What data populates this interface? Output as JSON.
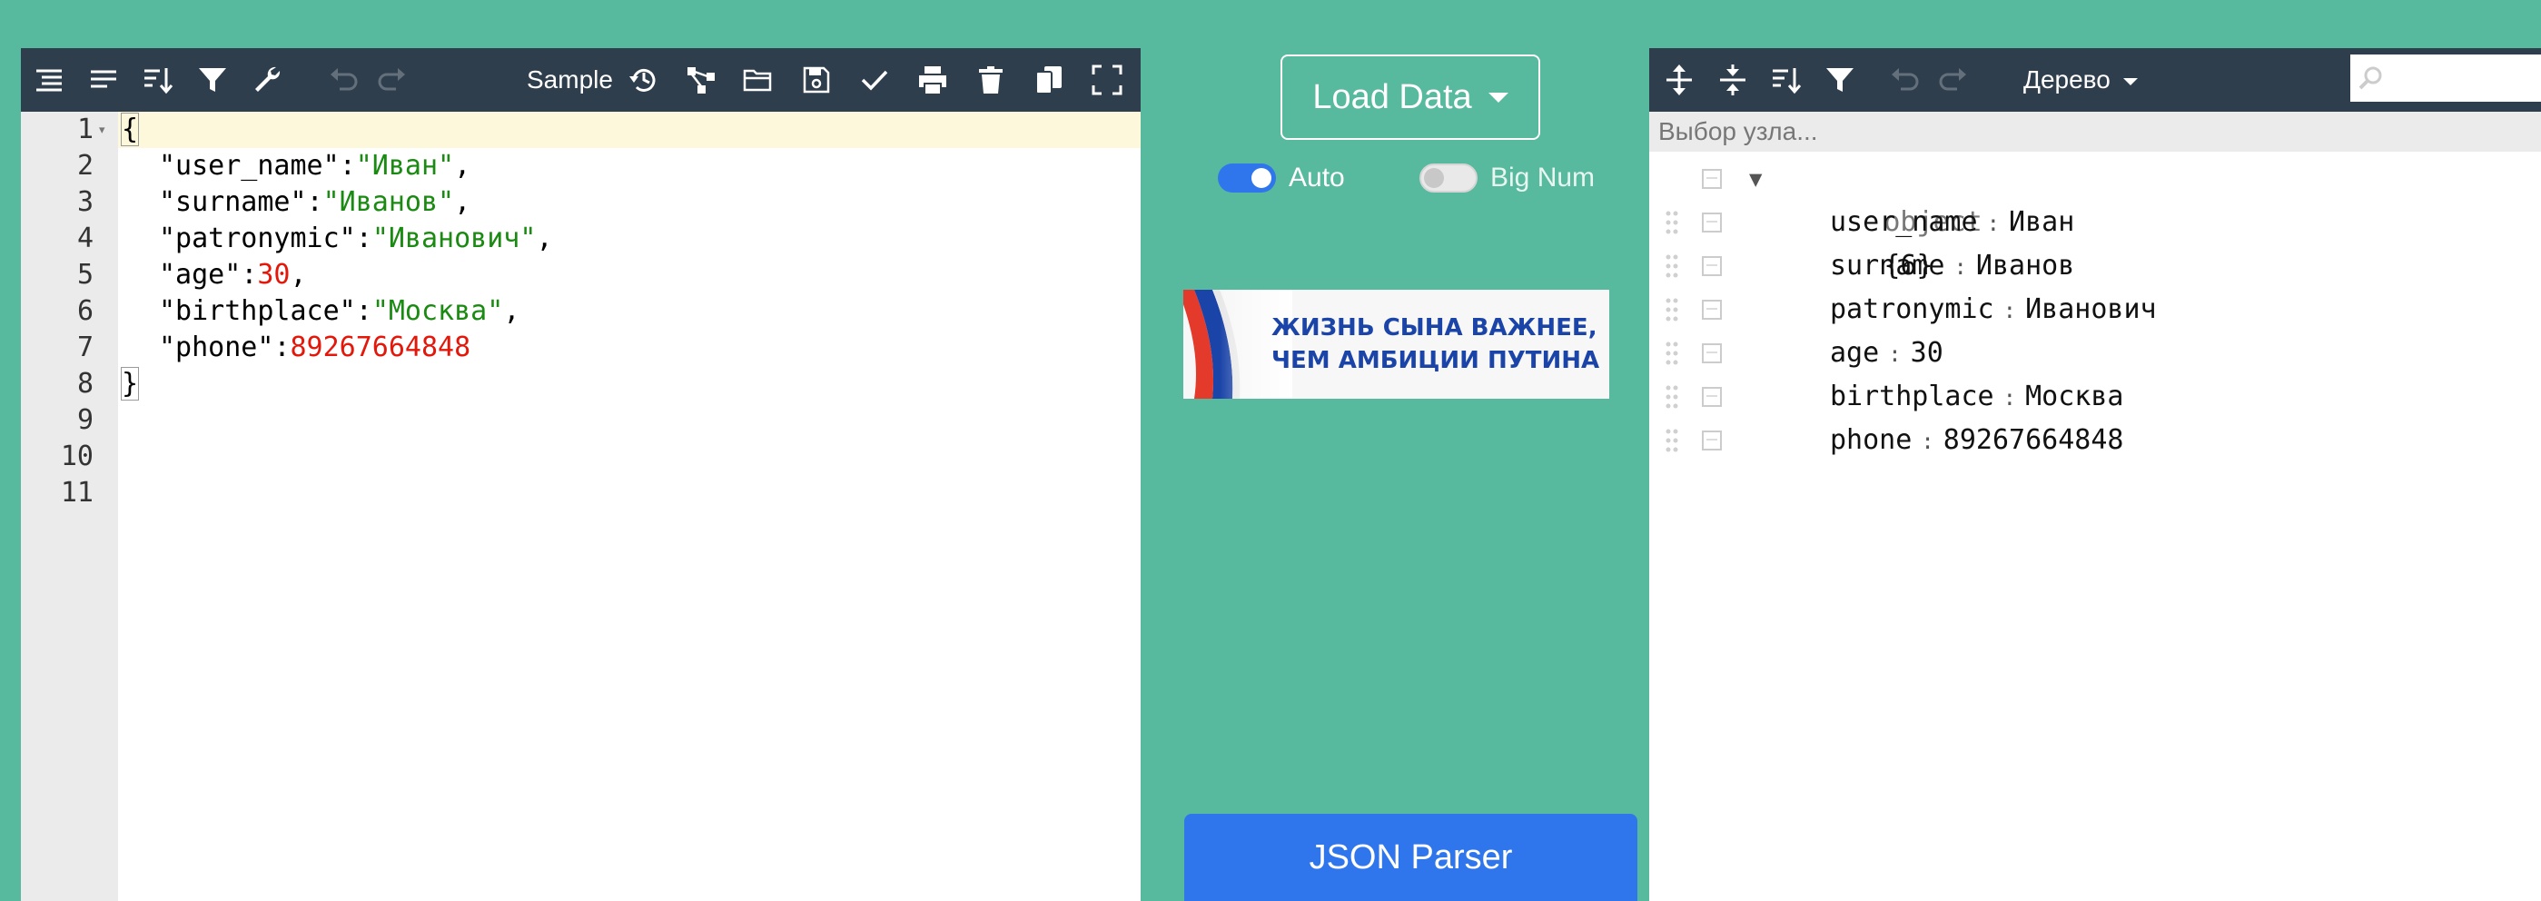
{
  "left_editor": {
    "toolbar": {
      "icons": [
        "format-icon",
        "compact-icon",
        "sort-icon",
        "filter-icon",
        "repair-icon",
        "undo-icon",
        "redo-icon",
        "history-icon",
        "transform-icon",
        "open-icon",
        "save-icon",
        "validate-icon",
        "print-icon",
        "clear-icon",
        "copy-icon",
        "fullscreen-icon"
      ],
      "sample_label": "Sample"
    },
    "line_numbers": [
      "1",
      "2",
      "3",
      "4",
      "5",
      "6",
      "7",
      "8",
      "9",
      "10",
      "11"
    ],
    "code": {
      "open_brace": "{",
      "close_brace": "}",
      "lines": [
        {
          "key": "\"user_name\"",
          "colon": ":",
          "value": "\"Иван\"",
          "type": "string",
          "comma": ","
        },
        {
          "key": "\"surname\"",
          "colon": ":",
          "value": "\"Иванов\"",
          "type": "string",
          "comma": ","
        },
        {
          "key": "\"patronymic\"",
          "colon": ":",
          "value": "\"Иванович\"",
          "type": "string",
          "comma": ","
        },
        {
          "key": "\"age\"",
          "colon": ":",
          "value": "30",
          "type": "number",
          "comma": ","
        },
        {
          "key": "\"birthplace\"",
          "colon": ":",
          "value": "\"Москва\"",
          "type": "string",
          "comma": ","
        },
        {
          "key": "\"phone\"",
          "colon": ":",
          "value": "89267664848",
          "type": "number",
          "comma": ""
        }
      ]
    }
  },
  "middle": {
    "load_data_label": "Load Data",
    "toggles": [
      {
        "label": "Auto",
        "on": true
      },
      {
        "label": "Big Num",
        "on": false
      }
    ],
    "banner": {
      "line1": "ЖИЗНЬ СЫНА ВАЖНЕЕ,",
      "line2": "ЧЕМ АМБИЦИИ ПУТИНА"
    },
    "json_parser_label": "JSON Parser"
  },
  "right_tree": {
    "toolbar": {
      "icons": [
        "expand-all-icon",
        "collapse-all-icon",
        "sort-icon",
        "filter-icon",
        "undo-icon",
        "redo-icon",
        "search-icon"
      ],
      "mode_label": "Дерево",
      "search_placeholder": ""
    },
    "nav_bar_text": "Выбор узла...",
    "root": {
      "type": "object",
      "count": "{6}"
    },
    "nodes": [
      {
        "key": "user_name",
        "sep": ":",
        "value": "Иван"
      },
      {
        "key": "surname",
        "sep": ":",
        "value": "Иванов"
      },
      {
        "key": "patronymic",
        "sep": ":",
        "value": "Иванович"
      },
      {
        "key": "age",
        "sep": ":",
        "value": "30"
      },
      {
        "key": "birthplace",
        "sep": ":",
        "value": "Москва"
      },
      {
        "key": "phone",
        "sep": ":",
        "value": "89267664848"
      }
    ]
  },
  "colors": {
    "background": "#57b99d",
    "toolbar": "#2f3e4d",
    "string": "#1a8a12",
    "number": "#e3170a",
    "primary_button": "#2f76ec",
    "toggle_on": "#2f76ec",
    "banner_text": "#1b44a8"
  }
}
